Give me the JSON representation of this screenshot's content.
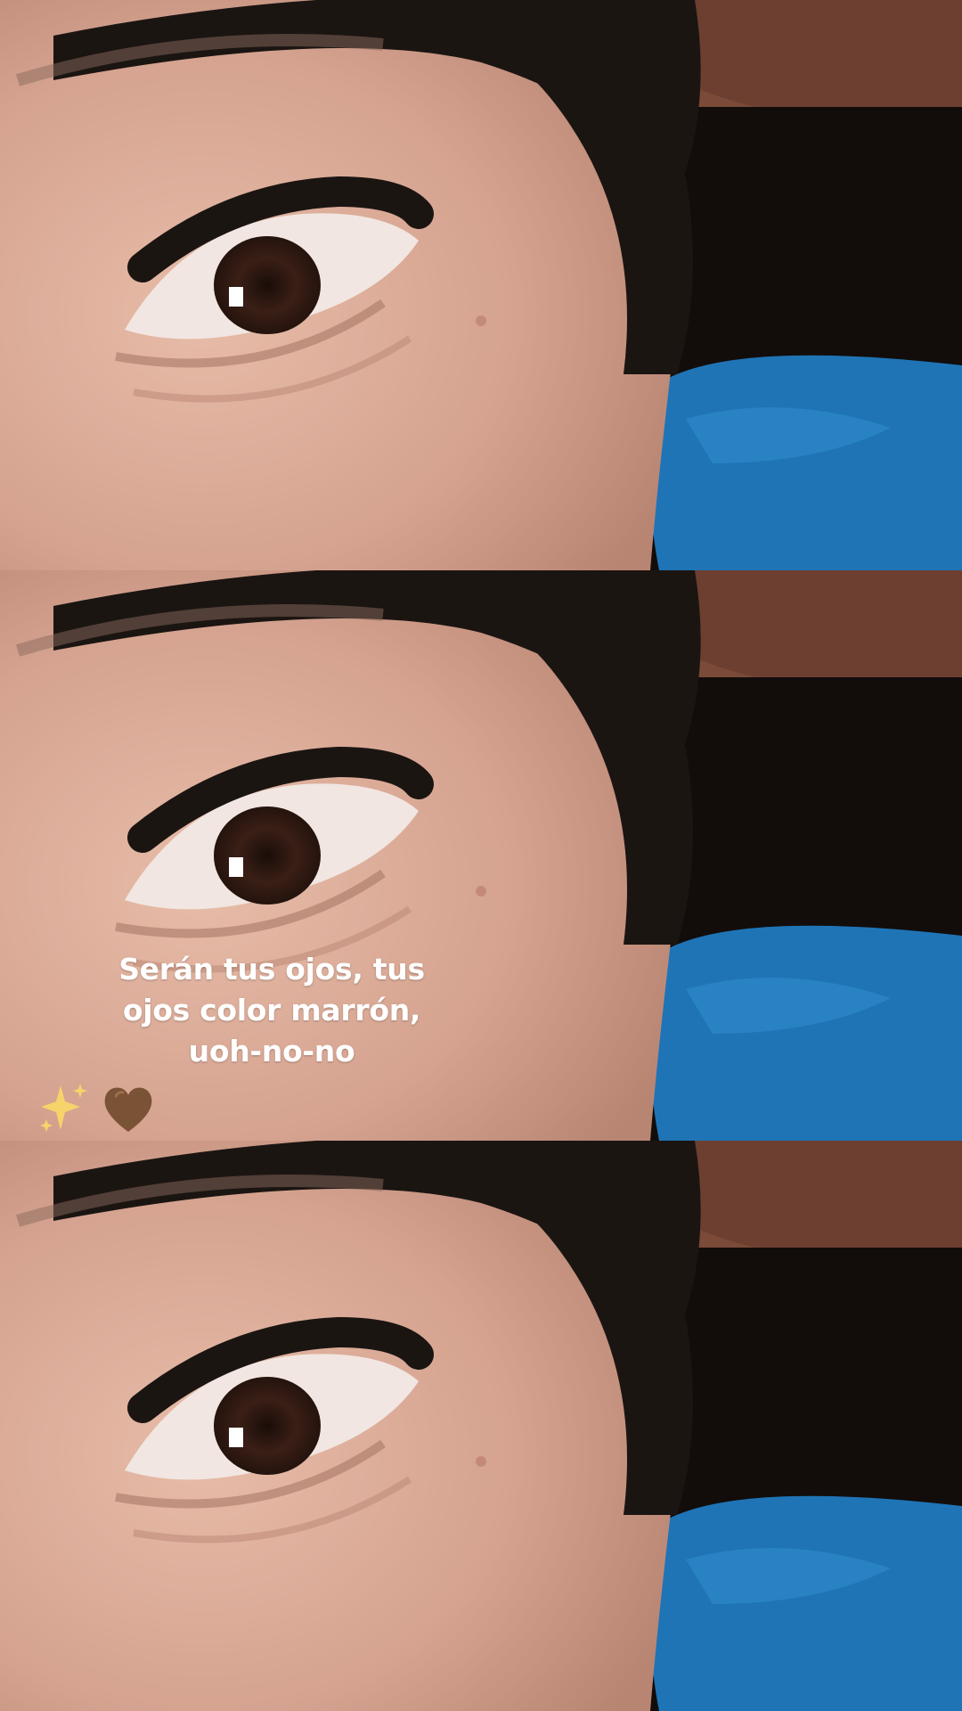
{
  "story": {
    "caption_lines": [
      "Serán tus ojos, tus",
      "ojos color marrón,",
      "uoh-no-no"
    ],
    "stickers": [
      {
        "name": "sparkles-icon",
        "glyph": "✨"
      },
      {
        "name": "brown-heart-icon",
        "glyph": "🤎"
      }
    ],
    "colors": {
      "skin": "#d9a995",
      "hair": "#1b1512",
      "iris": "#3a1f16",
      "blanket": "#1f74b6",
      "background_shadow": "#120d0b",
      "heart": "#7a5235",
      "sparkle": "#f6d36b"
    }
  }
}
